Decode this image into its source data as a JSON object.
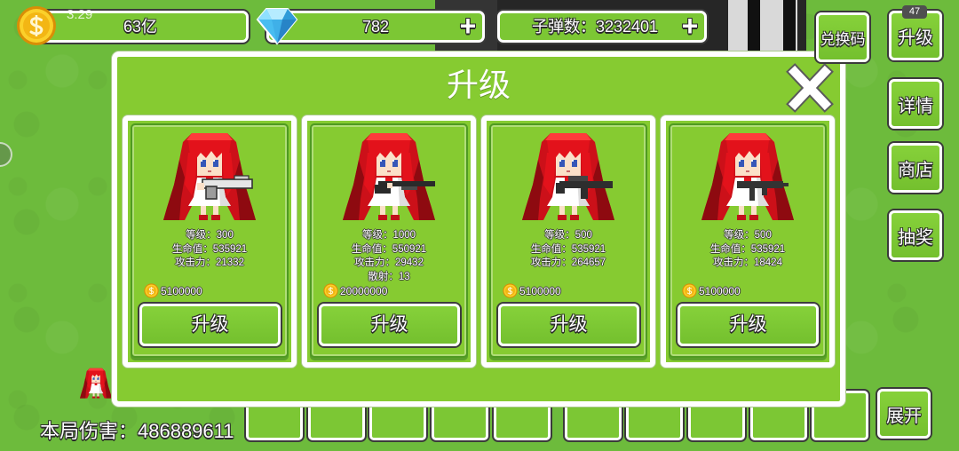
{
  "status_time": "3:29",
  "top_bar": {
    "gold": {
      "value": "63亿",
      "icon": "gold-coin-icon"
    },
    "diamond": {
      "value": "782",
      "add": "+",
      "icon": "diamond-icon"
    },
    "bullets": {
      "value": "子弹数：3232401",
      "add": "+"
    }
  },
  "side_menu": {
    "redeem_code": "兑换码",
    "upgrade": "升级",
    "upgrade_badge": "47",
    "details": "详情",
    "shop": "商店",
    "lottery": "抽奖",
    "expand": "展开"
  },
  "hud": {
    "damage": "本局伤害：486889611"
  },
  "modal": {
    "title": "升级",
    "close_icon": "close-icon",
    "cards": [
      {
        "sprite": "red-hair-girl-pistol-icon",
        "stats": [
          "等级：300",
          "生命值：535921",
          "攻击力：21332"
        ],
        "cost": "5100000",
        "button": "升级"
      },
      {
        "sprite": "red-hair-girl-shotgun-icon",
        "stats": [
          "等级：1000",
          "生命值：550921",
          "攻击力：29432",
          "散射：13"
        ],
        "cost": "20000000",
        "button": "升级"
      },
      {
        "sprite": "red-hair-girl-rifle-icon",
        "stats": [
          "等级：500",
          "生命值：535921",
          "攻击力：264657"
        ],
        "cost": "5100000",
        "button": "升级"
      },
      {
        "sprite": "red-hair-girl-smg-icon",
        "stats": [
          "等级：500",
          "生命值：535921",
          "攻击力：18424"
        ],
        "cost": "5100000",
        "button": "升级"
      }
    ]
  },
  "icons": {
    "currency": "gold-coin-icon",
    "gem": "diamond-icon",
    "cost": "coin-icon",
    "close": "close-icon"
  },
  "colors": {
    "button_green": "#7cc734",
    "panel_green": "#86cb31",
    "grass_green": "#6dbb3c",
    "outline": "#2b2b2b"
  }
}
